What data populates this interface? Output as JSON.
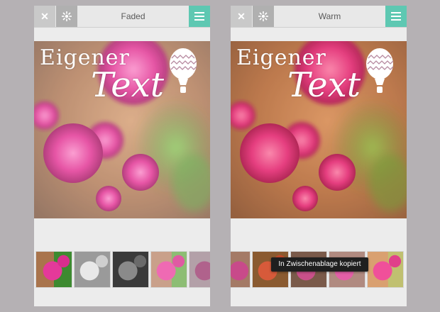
{
  "left": {
    "close_icon": "✕",
    "filter_title": "Faded",
    "overlay_text_line1": "Eigener",
    "overlay_text_line2": "Text"
  },
  "right": {
    "close_icon": "✕",
    "filter_title": "Warm",
    "overlay_text_line1": "Eigener",
    "overlay_text_line2": "Text",
    "toast": "In Zwischenablage kopiert"
  },
  "colors": {
    "accent": "#5ec8b2",
    "background": "#b5b1b4",
    "toast_bg": "#1f1f1f"
  },
  "icons": [
    "close-icon",
    "aperture-icon",
    "hamburger-menu-icon",
    "balloon-icon"
  ]
}
